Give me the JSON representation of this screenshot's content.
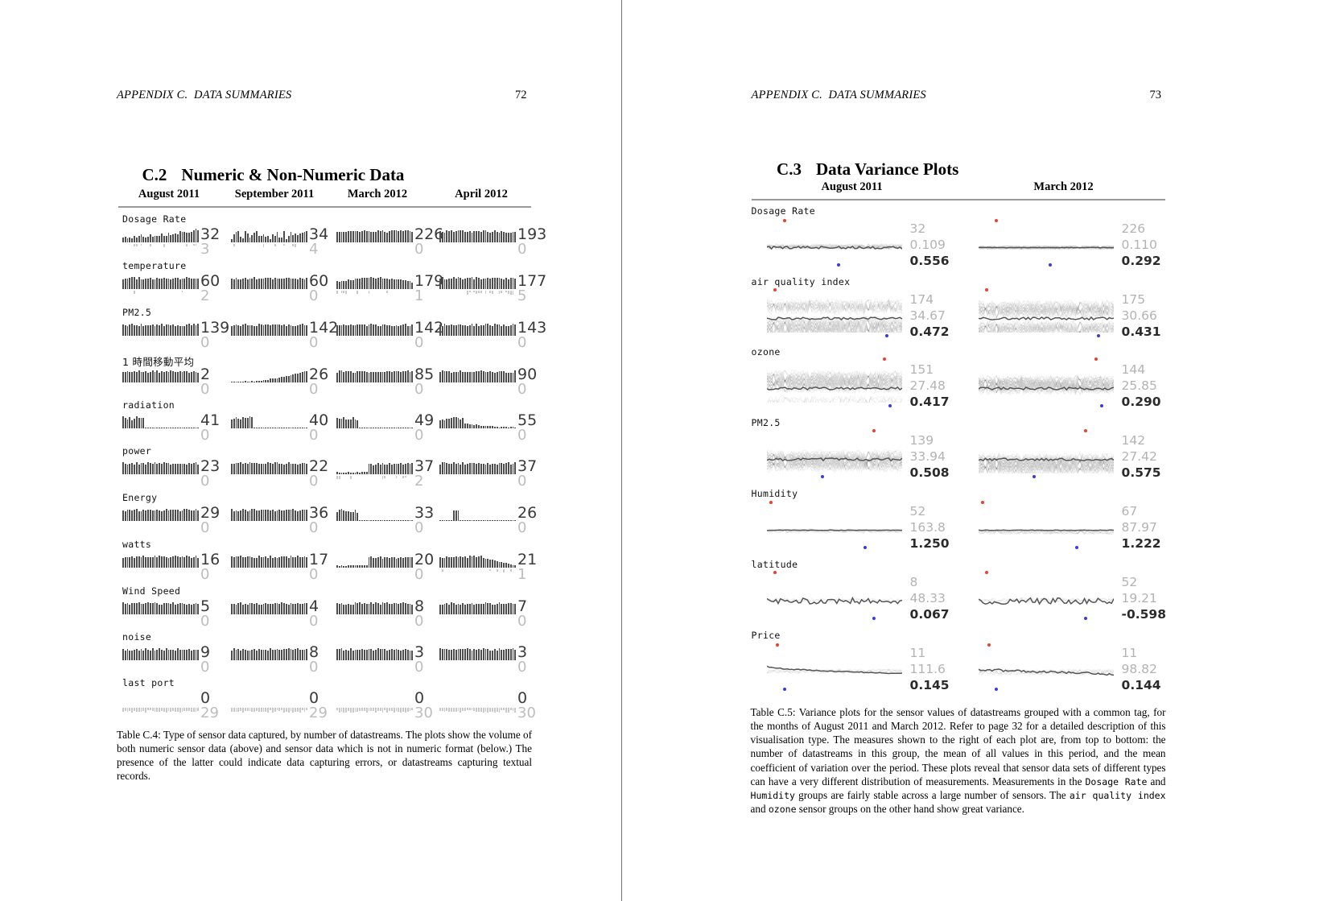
{
  "left_page": {
    "running_head": "APPENDIX C.  DATA SUMMARIES",
    "page_number": "72",
    "section": {
      "number": "C.2",
      "title": "Numeric & Non-Numeric Data"
    },
    "columns": [
      "August 2011",
      "September 2011",
      "March 2012",
      "April 2012"
    ],
    "rows": [
      {
        "label": "Dosage Rate",
        "cells": [
          {
            "numeric": "32",
            "nonnumeric": "3"
          },
          {
            "numeric": "34",
            "nonnumeric": "4"
          },
          {
            "numeric": "226",
            "nonnumeric": "0"
          },
          {
            "numeric": "193",
            "nonnumeric": "0"
          }
        ]
      },
      {
        "label": "temperature",
        "cells": [
          {
            "numeric": "60",
            "nonnumeric": "2"
          },
          {
            "numeric": "60",
            "nonnumeric": "0"
          },
          {
            "numeric": "179",
            "nonnumeric": "1"
          },
          {
            "numeric": "177",
            "nonnumeric": "5"
          }
        ]
      },
      {
        "label": "PM2.5",
        "cells": [
          {
            "numeric": "139",
            "nonnumeric": "0"
          },
          {
            "numeric": "142",
            "nonnumeric": "0"
          },
          {
            "numeric": "142",
            "nonnumeric": "0"
          },
          {
            "numeric": "143",
            "nonnumeric": "0"
          }
        ]
      },
      {
        "label": "1 時間移動平均",
        "cjk": true,
        "cells": [
          {
            "numeric": "2",
            "nonnumeric": "0"
          },
          {
            "numeric": "26",
            "nonnumeric": "0"
          },
          {
            "numeric": "85",
            "nonnumeric": "0"
          },
          {
            "numeric": "90",
            "nonnumeric": "0"
          }
        ]
      },
      {
        "label": "radiation",
        "cells": [
          {
            "numeric": "41",
            "nonnumeric": "0"
          },
          {
            "numeric": "40",
            "nonnumeric": "0"
          },
          {
            "numeric": "49",
            "nonnumeric": "0"
          },
          {
            "numeric": "55",
            "nonnumeric": "0"
          }
        ]
      },
      {
        "label": "power",
        "cells": [
          {
            "numeric": "23",
            "nonnumeric": "0"
          },
          {
            "numeric": "22",
            "nonnumeric": "0"
          },
          {
            "numeric": "37",
            "nonnumeric": "2"
          },
          {
            "numeric": "37",
            "nonnumeric": "0"
          }
        ]
      },
      {
        "label": "Energy",
        "cells": [
          {
            "numeric": "29",
            "nonnumeric": "0"
          },
          {
            "numeric": "36",
            "nonnumeric": "0"
          },
          {
            "numeric": "33",
            "nonnumeric": "0"
          },
          {
            "numeric": "26",
            "nonnumeric": "0"
          }
        ]
      },
      {
        "label": "watts",
        "cells": [
          {
            "numeric": "16",
            "nonnumeric": "0"
          },
          {
            "numeric": "17",
            "nonnumeric": "0"
          },
          {
            "numeric": "20",
            "nonnumeric": "0"
          },
          {
            "numeric": "21",
            "nonnumeric": "1"
          }
        ]
      },
      {
        "label": "Wind Speed",
        "cells": [
          {
            "numeric": "5",
            "nonnumeric": "0"
          },
          {
            "numeric": "4",
            "nonnumeric": "0"
          },
          {
            "numeric": "8",
            "nonnumeric": "0"
          },
          {
            "numeric": "7",
            "nonnumeric": "0"
          }
        ]
      },
      {
        "label": "noise",
        "cells": [
          {
            "numeric": "9",
            "nonnumeric": "0"
          },
          {
            "numeric": "8",
            "nonnumeric": "0"
          },
          {
            "numeric": "3",
            "nonnumeric": "0"
          },
          {
            "numeric": "3",
            "nonnumeric": "0"
          }
        ]
      },
      {
        "label": "last port",
        "cells": [
          {
            "numeric": "0",
            "nonnumeric": "29"
          },
          {
            "numeric": "0",
            "nonnumeric": "29"
          },
          {
            "numeric": "0",
            "nonnumeric": "30"
          },
          {
            "numeric": "0",
            "nonnumeric": "30"
          }
        ]
      }
    ],
    "caption": "Table C.4: Type of sensor data captured, by number of datastreams. The plots show the volume of both numeric sensor data (above) and sensor data which is not in numeric format (below.) The presence of the latter could indicate data capturing errors, or datastreams capturing textual records."
  },
  "right_page": {
    "running_head": "APPENDIX C.  DATA SUMMARIES",
    "page_number": "73",
    "section": {
      "number": "C.3",
      "title": "Data Variance Plots"
    },
    "columns": [
      "August 2011",
      "March 2012"
    ],
    "rows": [
      {
        "label": "Dosage Rate",
        "cells": [
          {
            "count": "32",
            "mean": "0.109",
            "cv": "0.556"
          },
          {
            "count": "226",
            "mean": "0.110",
            "cv": "0.292"
          }
        ]
      },
      {
        "label": "air quality index",
        "cells": [
          {
            "count": "174",
            "mean": "34.67",
            "cv": "0.472"
          },
          {
            "count": "175",
            "mean": "30.66",
            "cv": "0.431"
          }
        ]
      },
      {
        "label": "ozone",
        "cells": [
          {
            "count": "151",
            "mean": "27.48",
            "cv": "0.417"
          },
          {
            "count": "144",
            "mean": "25.85",
            "cv": "0.290"
          }
        ]
      },
      {
        "label": "PM2.5",
        "cells": [
          {
            "count": "139",
            "mean": "33.94",
            "cv": "0.508"
          },
          {
            "count": "142",
            "mean": "27.42",
            "cv": "0.575"
          }
        ]
      },
      {
        "label": "Humidity",
        "cells": [
          {
            "count": "52",
            "mean": "163.8",
            "cv": "1.250"
          },
          {
            "count": "67",
            "mean": "87.97",
            "cv": "1.222"
          }
        ]
      },
      {
        "label": "latitude",
        "cells": [
          {
            "count": "8",
            "mean": "48.33",
            "cv": "0.067"
          },
          {
            "count": "52",
            "mean": "19.21",
            "cv": "-0.598"
          }
        ]
      },
      {
        "label": "Price",
        "cells": [
          {
            "count": "11",
            "mean": "111.6",
            "cv": "0.145"
          },
          {
            "count": "11",
            "mean": "98.82",
            "cv": "0.144"
          }
        ]
      }
    ],
    "caption_part1": "Table C.5: Variance plots for the sensor values of datastreams grouped with a common tag, for the months of August 2011 and March 2012. Refer to page 32 for a detailed description of this visualisation type. The measures shown to the right of each plot are, from top to bottom: the number of datastreams in this group, the mean of all values in this period, and the mean coefficient of variation over the period. These plots reveal that sensor data sets of different types can have a very different distribution of measurements. Measurements in the ",
    "caption_mono1": "Dosage Rate",
    "caption_part2": " and ",
    "caption_mono2": "Humidity",
    "caption_part3": " groups are fairly stable across a large number of sensors. The ",
    "caption_mono3": "air quality index",
    "caption_part4": " and ",
    "caption_mono4": "ozone",
    "caption_part5": " sensor groups on the other hand show great variance."
  },
  "colors": {
    "bar_dark": "#4d4d4d",
    "bar_light": "#c9c9c9",
    "value_dark": "#3a3a3a",
    "value_light": "#bdbdbd",
    "max_dot": "#e8412f",
    "min_dot": "#3a3ae0",
    "rule": "#9a9a9a"
  }
}
